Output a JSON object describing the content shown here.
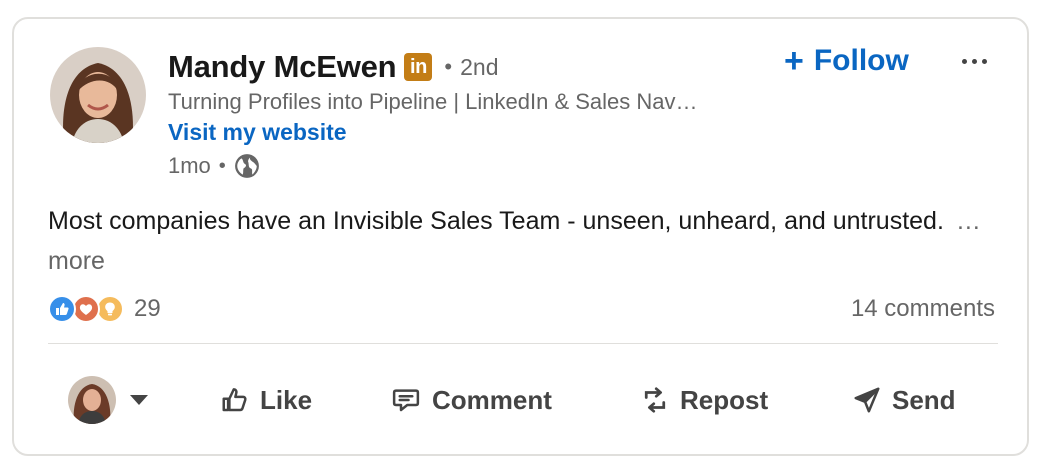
{
  "author": {
    "name": "Mandy McEwen",
    "badge": "in",
    "degree": "2nd",
    "headline": "Turning Profiles into Pipeline | LinkedIn & Sales Nav…",
    "website_link": "Visit my website",
    "time": "1mo",
    "visibility_icon": "globe-icon"
  },
  "header_actions": {
    "follow_label": "Follow",
    "more_icon": "more-horizontal-icon"
  },
  "post": {
    "text": "Most companies have an Invisible Sales Team - unseen, unheard, and untrusted.",
    "see_more": "…more"
  },
  "social": {
    "reaction_icons": [
      "like-icon",
      "love-icon",
      "insightful-icon"
    ],
    "reaction_count": "29",
    "comments": "14 comments"
  },
  "actions": {
    "like": "Like",
    "comment": "Comment",
    "repost": "Repost",
    "send": "Send"
  },
  "colors": {
    "brand_blue": "#0a66c2",
    "linkedin_badge": "#c37d16",
    "muted_text": "#666666",
    "border": "#e0dfdc"
  }
}
